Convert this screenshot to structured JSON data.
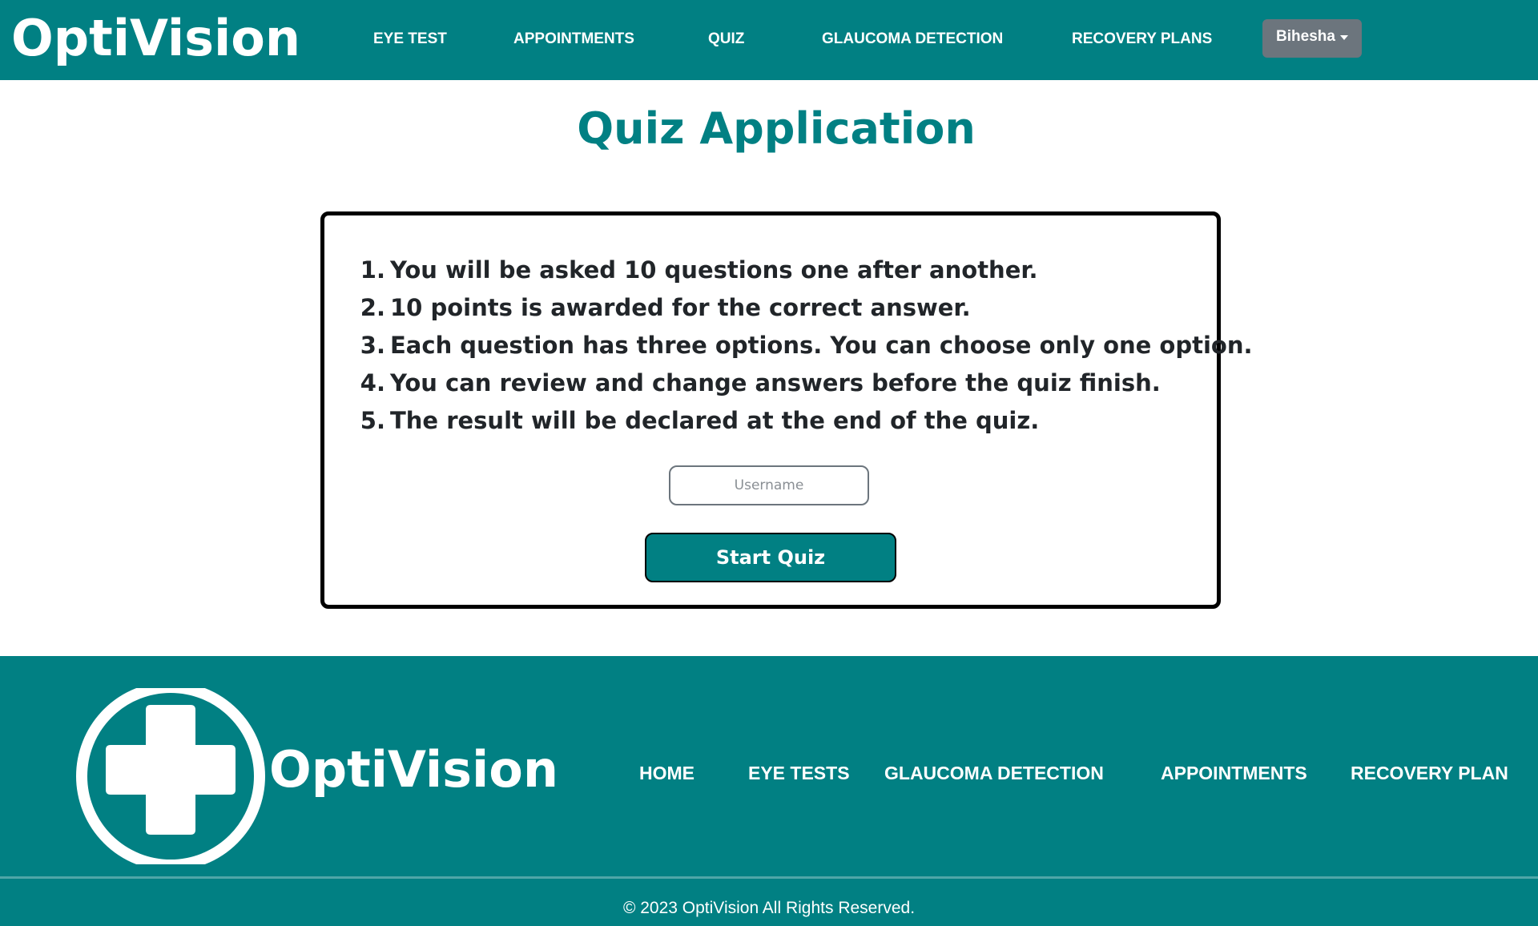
{
  "header": {
    "brand": "OptiVision",
    "nav": [
      {
        "label": "EYE TEST"
      },
      {
        "label": "APPOINTMENTS"
      },
      {
        "label": "QUIZ"
      },
      {
        "label": "GLAUCOMA DETECTION"
      },
      {
        "label": "RECOVERY PLANS"
      }
    ],
    "user_menu": {
      "label": "Bihesha"
    }
  },
  "main": {
    "title": "Quiz Application",
    "rules": [
      {
        "num": "1.",
        "text": "You will be asked 10 questions one after another."
      },
      {
        "num": "2.",
        "text": "10 points is awarded for the correct answer."
      },
      {
        "num": "3.",
        "text": "Each question has three options. You can choose only one option."
      },
      {
        "num": "4.",
        "text": "You can review and change answers before the quiz finish."
      },
      {
        "num": "5.",
        "text": "The result will be declared at the end of the quiz."
      }
    ],
    "username": {
      "value": "",
      "placeholder": "Username"
    },
    "start_button": "Start Quiz"
  },
  "footer": {
    "logo_icon": "medical-cross-icon",
    "brand": "OptiVision",
    "nav": [
      {
        "label": "HOME"
      },
      {
        "label": "EYE TESTS"
      },
      {
        "label": "GLAUCOMA DETECTION"
      },
      {
        "label": "APPOINTMENTS"
      },
      {
        "label": "RECOVERY PLAN"
      }
    ],
    "copyright": "© 2023 OptiVision All Rights Reserved."
  },
  "colors": {
    "primary": "#018083",
    "user_button": "#6c757d",
    "text_dark": "#212529",
    "card_border": "#000000"
  }
}
